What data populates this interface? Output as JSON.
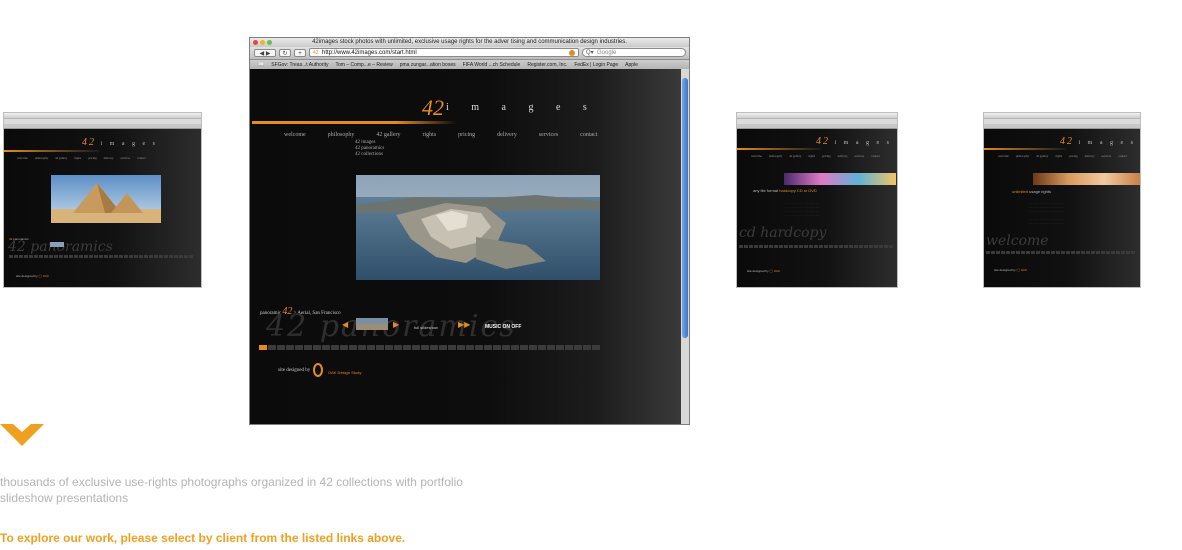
{
  "browser": {
    "window_title": "42images stock photos with unlimited, exclusive usage rights for the adver tising and communication design industries.",
    "url": "http://www.42images.com/start.html",
    "search_placeholder": "Google",
    "bookmarks": [
      "SFGov: Treas...t Authority",
      "Tom – Comp...e – Review",
      "pma zungar...ation boxes",
      "FIFA World ...ch Schedule",
      "Register.com, Inc.",
      "FedEx | Login Page",
      "Apple"
    ]
  },
  "site": {
    "logo_number": "42",
    "logo_word": "i m a g e s",
    "nav": [
      "welcome",
      "philosophy",
      "42 gallery",
      "rights",
      "pricing",
      "delivery",
      "services",
      "contact"
    ],
    "subnav": [
      "42 images",
      "42 panoramics",
      "42 collections"
    ],
    "panoramic_prefix": "panoramic",
    "panoramic_caption": "Aerial, San Francisco",
    "script_text": "42 panoramics",
    "slideshow_label": "full slideshow",
    "music_label": "MUSIC ON OFF",
    "designed_by": "site designed by",
    "design_firm": "OAK Design Study"
  },
  "thumbnails": {
    "t1_script": "42 panoramics",
    "t2_label": "any file format",
    "t2_label_orange": "hardcopy CD or DVD",
    "t2_script": "cd hardcopy",
    "t3_label": "unlimited",
    "t3_label_orange": "usage rights",
    "t3_script": "welcome"
  },
  "footer": {
    "description": "thousands of exclusive use-rights photographs organized in 42 collections with portfolio slideshow presentations",
    "cta": "To explore our work, please select by client from the listed links above."
  },
  "colors": {
    "accent_orange": "#e58b1f",
    "cta_orange": "#f0a020",
    "page_black": "#0b0b0b"
  }
}
